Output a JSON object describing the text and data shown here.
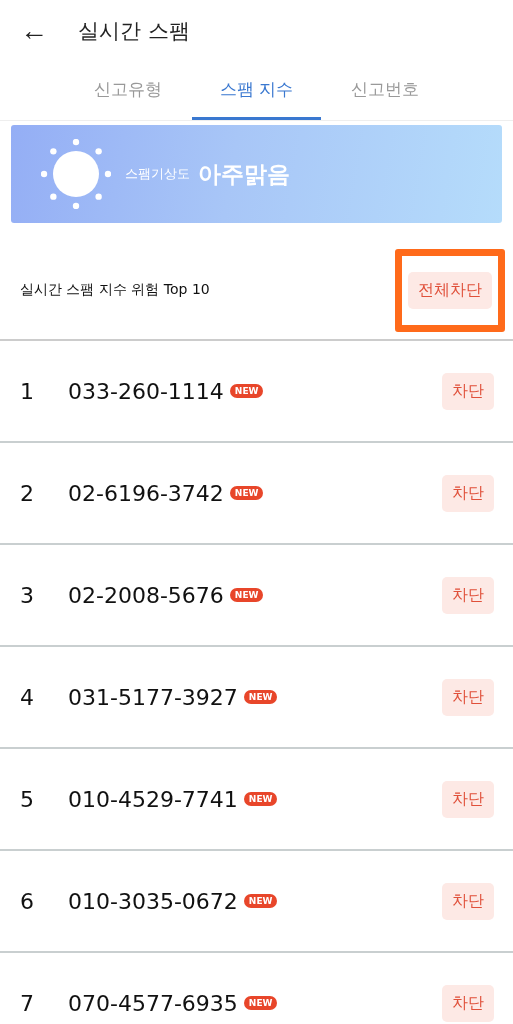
{
  "header": {
    "back": "←",
    "title": "실시간 스팸"
  },
  "tabs": [
    {
      "label": "신고유형",
      "selected": false
    },
    {
      "label": "스팸 지수",
      "selected": true
    },
    {
      "label": "신고번호",
      "selected": false
    }
  ],
  "banner": {
    "label": "스팸기상도",
    "value": "아주맑음"
  },
  "section": {
    "title": "실시간 스팸 지수 위험 Top 10",
    "block_all": "전체차단",
    "highlighted": true
  },
  "rows": [
    {
      "rank": "1",
      "number": "033-260-1114",
      "badge": "NEW",
      "action": "차단"
    },
    {
      "rank": "2",
      "number": "02-6196-3742",
      "badge": "NEW",
      "action": "차단"
    },
    {
      "rank": "3",
      "number": "02-2008-5676",
      "badge": "NEW",
      "action": "차단"
    },
    {
      "rank": "4",
      "number": "031-5177-3927",
      "badge": "NEW",
      "action": "차단"
    },
    {
      "rank": "5",
      "number": "010-4529-7741",
      "badge": "NEW",
      "action": "차단"
    },
    {
      "rank": "6",
      "number": "010-3035-0672",
      "badge": "NEW",
      "action": "차단"
    },
    {
      "rank": "7",
      "number": "070-4577-6935",
      "badge": "NEW",
      "action": "차단"
    }
  ]
}
